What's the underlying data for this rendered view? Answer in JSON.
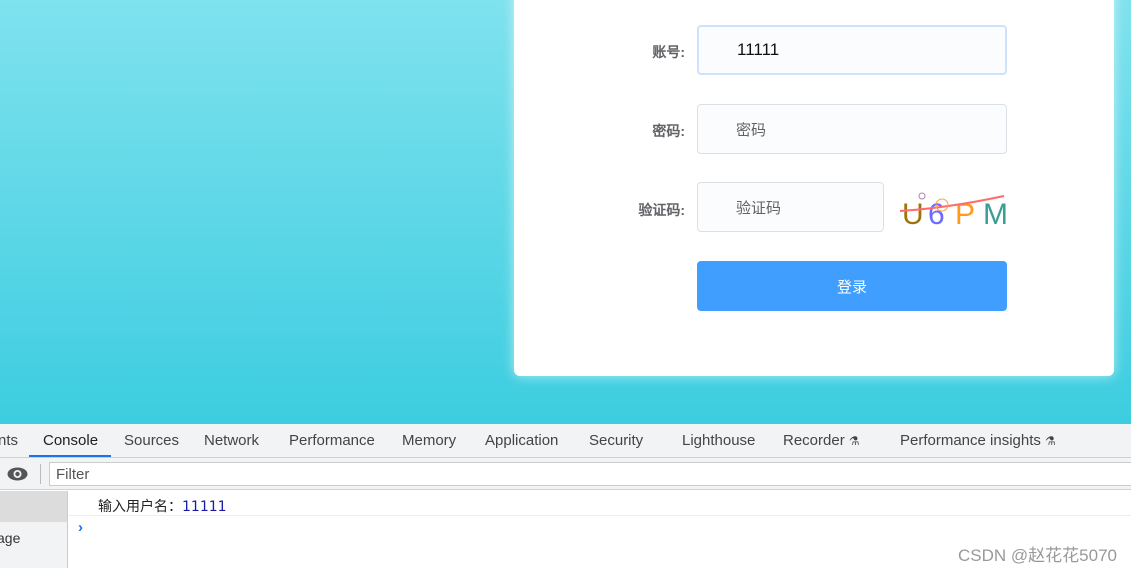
{
  "form": {
    "account_label": "账号:",
    "account_value": "11111",
    "password_label": "密码:",
    "password_placeholder": "密码",
    "captcha_label": "验证码:",
    "captcha_placeholder": "验证码",
    "captcha_chars": [
      "U",
      "6",
      "P",
      "M"
    ],
    "captcha_colors": [
      "#a0720a",
      "#6b6bff",
      "#ff9a1a",
      "#3a9d95"
    ],
    "login_button": "登录",
    "button_color": "#409eff"
  },
  "devtools": {
    "tabs": [
      "nts",
      "Console",
      "Sources",
      "Network",
      "Performance",
      "Memory",
      "Application",
      "Security",
      "Lighthouse",
      "Recorder",
      "Performance insights"
    ],
    "active_tab": "Console",
    "filter_placeholder": "Filter",
    "sidebar_item": "age",
    "log_prefix": "输入用户名：",
    "log_value": "11111"
  },
  "watermark": "CSDN @赵花花5070"
}
